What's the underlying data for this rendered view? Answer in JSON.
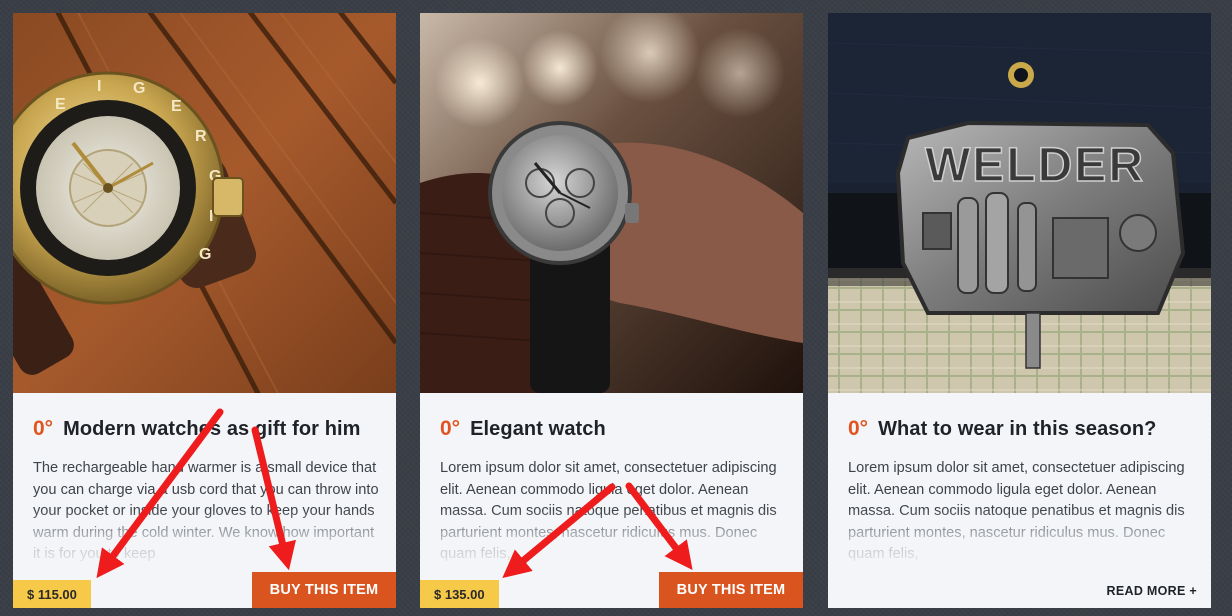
{
  "cards": [
    {
      "likes": "0°",
      "title": "Modern watches as gift for him",
      "text": "The rechargeable hand warmer is a small device that you can charge via a usb cord that you can throw into your pocket or inside your gloves to keep your hands warm during the cold winter. We know how important it is for you to keep",
      "price": "$ 115.00",
      "action_label": "BUY THIS ITEM",
      "image": "gold-wristwatch-on-wood"
    },
    {
      "likes": "0°",
      "title": "Elegant watch",
      "text": "Lorem ipsum dolor sit amet, consectetuer adipiscing elit. Aenean commodo ligula eget dolor. Aenean massa. Cum sociis natoque penatibus et magnis dis parturient montes, nascetur ridiculus mus. Donec quam felis,",
      "price": "$ 135.00",
      "action_label": "BUY THIS ITEM",
      "image": "wristwatch-on-wrist"
    },
    {
      "likes": "0°",
      "title": "What to wear in this season?",
      "text": "Lorem ipsum dolor sit amet, consectetuer adipiscing elit. Aenean commodo ligula eget dolor. Aenean massa. Cum sociis natoque penatibus et magnis dis parturient montes, nascetur ridiculus mus. Donec quam felis,",
      "action_label": "READ MORE +",
      "image": "welder-belt-buckle",
      "image_lettering": "WELDER"
    }
  ],
  "colors": {
    "page_background": "#3a3f47",
    "card_background": "#f3f5f8",
    "accent_orange": "#d9541e",
    "likes_orange": "#e2541f",
    "price_yellow": "#f7c948",
    "annotation_red": "#ee1c1c"
  },
  "annotations": {
    "type": "red-arrows",
    "count": 4
  }
}
